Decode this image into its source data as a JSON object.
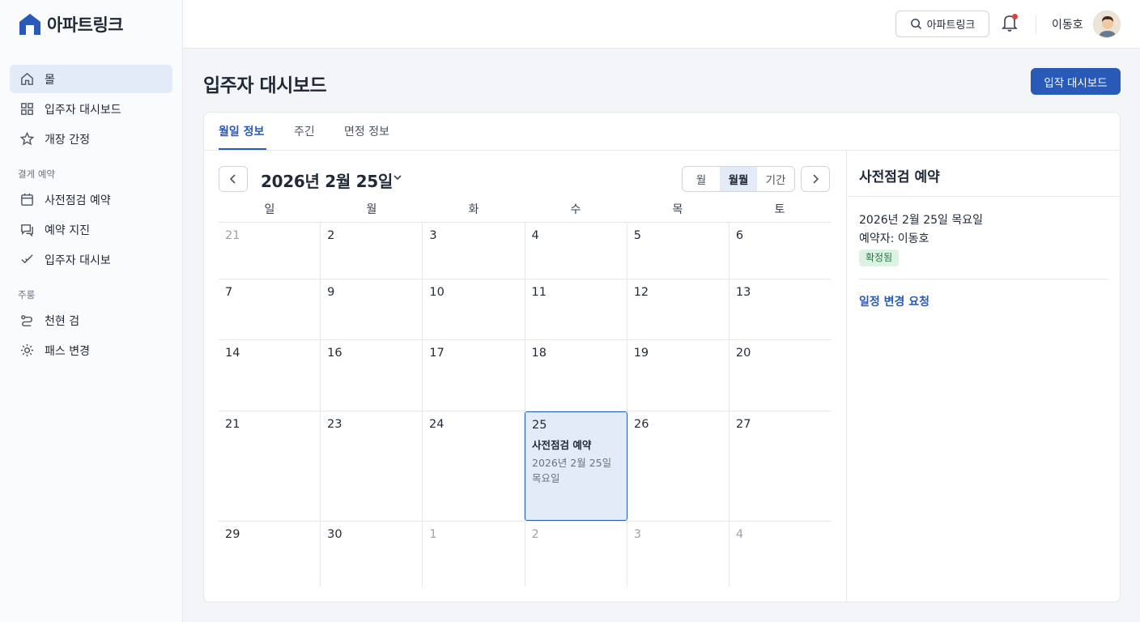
{
  "brand": {
    "name": "아파트링크",
    "color": "#2a5ab8"
  },
  "sidebar": {
    "items": [
      {
        "label": "몰",
        "icon": "home-icon",
        "active": true
      },
      {
        "label": "입주자 대시보드",
        "icon": "grid-icon"
      },
      {
        "label": "개장 간정",
        "icon": "star-icon"
      }
    ],
    "section1": "결게 예약",
    "items2": [
      {
        "label": "사전점검 예약",
        "icon": "calendar-icon"
      },
      {
        "label": "예약 지진",
        "icon": "chat-icon"
      },
      {
        "label": "입주자 대시보",
        "icon": "checklist-icon"
      }
    ],
    "section2": "주룽",
    "items3": [
      {
        "label": "천현 검",
        "icon": "route-icon"
      },
      {
        "label": "패스 변경",
        "icon": "gear-icon"
      }
    ]
  },
  "topbar": {
    "search_label": "아파트링크",
    "user_name": "이동호"
  },
  "page": {
    "title": "입주자 대시보드",
    "primary_button": "입작 대시보드"
  },
  "tabs": [
    "월일 정보",
    "주긴",
    "면정 정보"
  ],
  "calendar": {
    "title": "2026년 2월 25일",
    "views": [
      "월",
      "월뭘",
      "기간"
    ],
    "days_of_week": [
      "일",
      "월",
      "화",
      "수",
      "목",
      "토"
    ],
    "weeks": [
      [
        "21",
        "2",
        "3",
        "4",
        "5",
        "6"
      ],
      [
        "7",
        "9",
        "10",
        "11",
        "12",
        "13"
      ],
      [
        "14",
        "16",
        "17",
        "18",
        "19",
        "20"
      ],
      [
        "21",
        "23",
        "24",
        "25",
        "26",
        "27"
      ],
      [
        "29",
        "30",
        "1",
        "2",
        "3",
        "4"
      ]
    ],
    "event": {
      "title": "사전점검 예약",
      "date": "2026년 2월 25일 목요일"
    }
  },
  "side_panel": {
    "title": "사전점검 예약",
    "date": "2026년 2월 25일 목요일",
    "booker": "예약자: 이동호",
    "status": "확정됨",
    "link": "일정 변경 요청"
  }
}
